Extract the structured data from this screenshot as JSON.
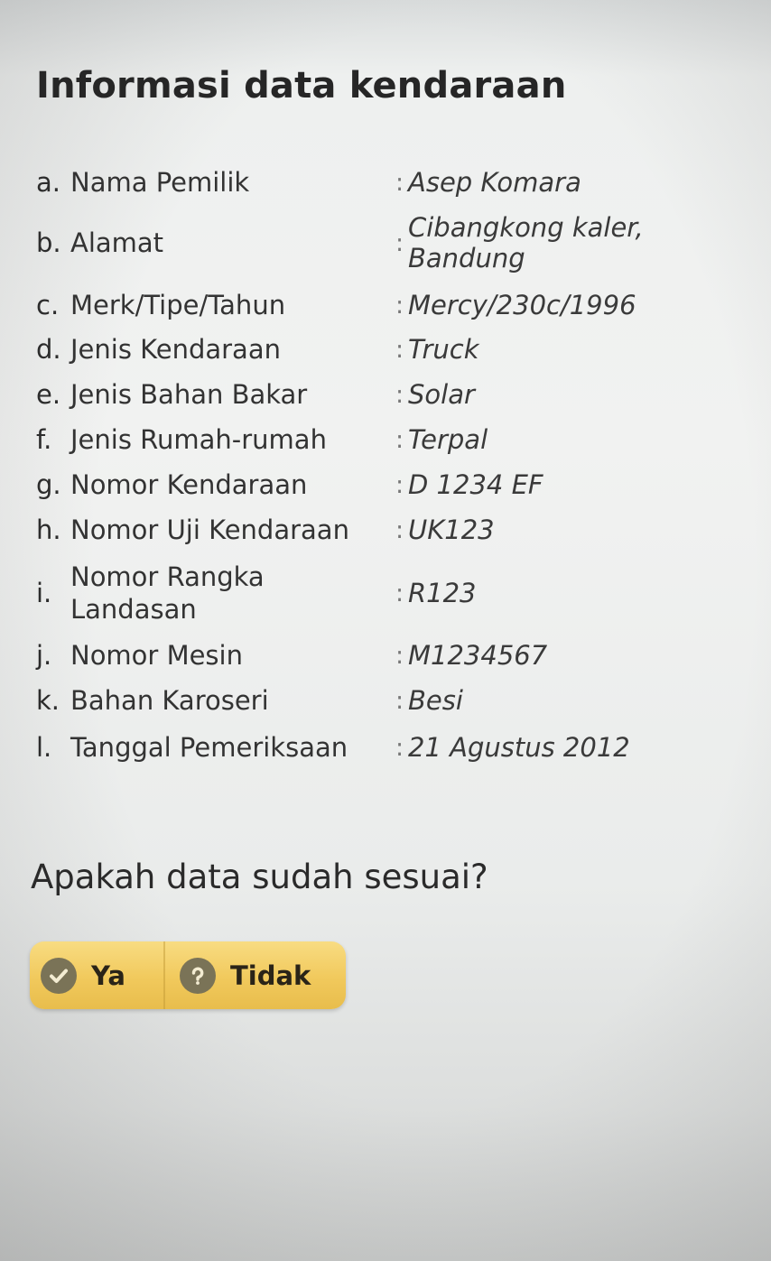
{
  "title": "Informasi data kendaraan",
  "rows": [
    {
      "letter": "a.",
      "label": "Nama Pemilik",
      "colon": ":",
      "value": "Asep Komara"
    },
    {
      "letter": "b.",
      "label": "Alamat",
      "colon": ":",
      "value": "Cibangkong kaler, Bandung"
    },
    {
      "letter": "c.",
      "label": "Merk/Tipe/Tahun",
      "colon": ":",
      "value": "Mercy/230c/1996"
    },
    {
      "letter": "d.",
      "label": "Jenis Kendaraan",
      "colon": ":",
      "value": "Truck"
    },
    {
      "letter": "e.",
      "label": "Jenis Bahan Bakar",
      "colon": ":",
      "value": "Solar"
    },
    {
      "letter": "f.",
      "label": "Jenis Rumah-rumah",
      "colon": ":",
      "value": "Terpal"
    },
    {
      "letter": "g.",
      "label": "Nomor Kendaraan",
      "colon": ":",
      "value": "D 1234 EF"
    },
    {
      "letter": "h.",
      "label": "Nomor Uji Kendaraan",
      "colon": ":",
      "value": "UK123"
    },
    {
      "letter": "i.",
      "label": "Nomor Rangka Landasan",
      "colon": ":",
      "value": "R123"
    },
    {
      "letter": "j.",
      "label": "Nomor Mesin",
      "colon": ":",
      "value": "M1234567"
    },
    {
      "letter": "k.",
      "label": "Bahan Karoseri",
      "colon": ":",
      "value": "Besi"
    },
    {
      "letter": "l.",
      "label": "Tanggal Pemeriksaan",
      "colon": ":",
      "value": "21 Agustus 2012"
    }
  ],
  "question": "Apakah data sudah sesuai?",
  "buttons": {
    "yes_label": "Ya",
    "yes_icon": "check-icon",
    "no_label": "Tidak",
    "no_icon": "question-icon"
  },
  "colors": {
    "button_bg": "#f1c95c",
    "icon_bg": "#7a7357"
  }
}
